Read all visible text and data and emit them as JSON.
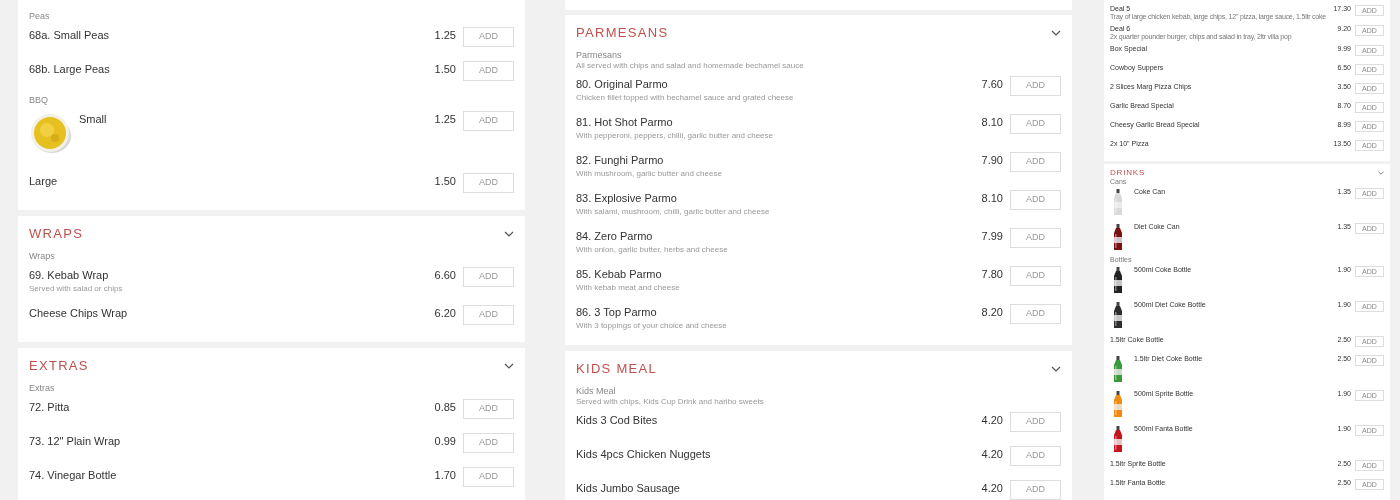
{
  "columns": [
    {
      "kind": "full",
      "cards": [
        {
          "groups": [
            {
              "label": "Peas",
              "items": [
                {
                  "kind": "plain",
                  "name": "68a. Small Peas",
                  "price": "1.25",
                  "button": "ADD"
                },
                {
                  "kind": "plain",
                  "name": "68b. Large Peas",
                  "price": "1.50",
                  "button": "ADD"
                }
              ]
            },
            {
              "label": "BBQ",
              "items": [
                {
                  "kind": "picture",
                  "name": "Small",
                  "price": "1.25",
                  "button": "ADD"
                },
                {
                  "kind": "plain",
                  "name": "Large",
                  "price": "1.50",
                  "button": "ADD"
                }
              ]
            }
          ]
        },
        {
          "title": "WRAPS",
          "expanded": true,
          "groups": [
            {
              "label": "Wraps",
              "items": [
                {
                  "kind": "plain",
                  "name": "69. Kebab Wrap",
                  "description": "Served with salad or chips",
                  "price": "6.60",
                  "button": "ADD"
                },
                {
                  "kind": "plain",
                  "name": "Cheese Chips Wrap",
                  "price": "6.20",
                  "button": "ADD"
                }
              ]
            }
          ]
        },
        {
          "title": "EXTRAS",
          "expanded": true,
          "groups": [
            {
              "label": "Extras",
              "items": [
                {
                  "kind": "plain",
                  "name": "72. Pitta",
                  "price": "0.85",
                  "button": "ADD"
                },
                {
                  "kind": "plain",
                  "name": "73. 12\" Plain Wrap",
                  "price": "0.99",
                  "button": "ADD"
                },
                {
                  "kind": "plain",
                  "name": "74. Vinegar Bottle",
                  "price": "1.70",
                  "button": "ADD"
                }
              ]
            }
          ]
        }
      ]
    },
    {
      "kind": "full",
      "cards": [
        {
          "title": "PARMESANS",
          "expanded": true,
          "groups": [
            {
              "label": "Parmesans",
              "description": "All served with chips and salad and homemade bechamel sauce",
              "items": [
                {
                  "kind": "plain",
                  "name": "80. Original Parmo",
                  "description": "Chicken fillet topped with bechamel sauce and grated cheese",
                  "price": "7.60",
                  "button": "ADD"
                },
                {
                  "kind": "plain",
                  "name": "81. Hot Shot Parmo",
                  "description": "With pepperoni, peppers, chilli, garlic butter and cheese",
                  "price": "8.10",
                  "button": "ADD"
                },
                {
                  "kind": "plain",
                  "name": "82. Funghi Parmo",
                  "description": "With mushroom, garlic butter and cheese",
                  "price": "7.90",
                  "button": "ADD"
                },
                {
                  "kind": "plain",
                  "name": "83. Explosive Parmo",
                  "description": "With salami, mushroom, chilli, garlic butter and cheese",
                  "price": "8.10",
                  "button": "ADD"
                },
                {
                  "kind": "plain",
                  "name": "84. Zero Parmo",
                  "description": "With onion, garlic butter, herbs and cheese",
                  "price": "7.99",
                  "button": "ADD"
                },
                {
                  "kind": "plain",
                  "name": "85. Kebab Parmo",
                  "description": "With kebab meat and cheese",
                  "price": "7.80",
                  "button": "ADD"
                },
                {
                  "kind": "plain",
                  "name": "86. 3 Top Parmo",
                  "description": "With 3 toppings of your choice and cheese",
                  "price": "8.20",
                  "button": "ADD"
                }
              ]
            }
          ]
        },
        {
          "title": "KIDS MEAL",
          "expanded": true,
          "groups": [
            {
              "label": "Kids Meal",
              "description": "Served with chips, Kids Cup Drink and haribo sweets",
              "items": [
                {
                  "kind": "plain",
                  "name": "Kids 3 Cod Bites",
                  "price": "4.20",
                  "button": "ADD"
                },
                {
                  "kind": "plain",
                  "name": "Kids 4pcs Chicken Nuggets",
                  "price": "4.20",
                  "button": "ADD"
                },
                {
                  "kind": "plain",
                  "name": "Kids Jumbo Sausage",
                  "price": "4.20",
                  "button": "ADD"
                }
              ]
            }
          ]
        }
      ]
    },
    {
      "kind": "miniature",
      "cards": [
        {
          "groups": [
            {
              "items": [
                {
                  "kind": "plain",
                  "name": "Deal 5",
                  "description": "Tray of large chicken kebab, large chips, 12\" pizza, large sauce, 1.5ltr coke",
                  "price": "17.30",
                  "button": "ADD"
                },
                {
                  "kind": "plain",
                  "name": "Deal 6",
                  "description": "2x quarter pounder burger, chips and salad in tray, 2ltr villa pop",
                  "price": "9.20",
                  "button": "ADD"
                },
                {
                  "kind": "plain",
                  "name": "Box Special",
                  "price": "9.99",
                  "button": "ADD"
                },
                {
                  "kind": "plain",
                  "name": "Cowboy Suppers",
                  "price": "6.50",
                  "button": "ADD"
                },
                {
                  "kind": "plain",
                  "name": "2 Slices Marg Pizza Chips",
                  "price": "3.50",
                  "button": "ADD"
                },
                {
                  "kind": "plain",
                  "name": "Garlic Bread Special",
                  "price": "8.70",
                  "button": "ADD"
                },
                {
                  "kind": "plain",
                  "name": "Cheesy Garlic Bread Special",
                  "price": "8.99",
                  "button": "ADD"
                },
                {
                  "kind": "plain",
                  "name": "2x 10\" Pizza",
                  "price": "13.50",
                  "button": "ADD"
                }
              ]
            }
          ]
        },
        {
          "title": "DRINKS",
          "expanded": true,
          "groups": [
            {
              "label": "Cans",
              "items": [
                {
                  "kind": "picture",
                  "name": "Coke Can",
                  "price": "1.35",
                  "button": "ADD"
                },
                {
                  "kind": "picture",
                  "name": "Diet Coke Can",
                  "price": "1.35",
                  "button": "ADD"
                }
              ]
            },
            {
              "label": "Bottles",
              "items": [
                {
                  "kind": "picture",
                  "name": "500ml Coke Bottle",
                  "price": "1.90",
                  "button": "ADD"
                },
                {
                  "kind": "picture",
                  "name": "500ml Diet Coke Bottle",
                  "price": "1.90",
                  "button": "ADD"
                },
                {
                  "kind": "plain",
                  "name": "1.5ltr Coke Bottle",
                  "price": "2.50",
                  "button": "ADD"
                },
                {
                  "kind": "picture",
                  "name": "1.5ltr Diet Coke Bottle",
                  "price": "2.50",
                  "button": "ADD"
                },
                {
                  "kind": "picture",
                  "name": "500ml Sprite Bottle",
                  "price": "1.90",
                  "button": "ADD"
                },
                {
                  "kind": "picture",
                  "name": "500ml Fanta Bottle",
                  "price": "1.90",
                  "button": "ADD"
                },
                {
                  "kind": "plain",
                  "name": "1.5ltr Sprite Bottle",
                  "price": "2.50",
                  "button": "ADD"
                },
                {
                  "kind": "plain",
                  "name": "1.5ltr Fanta Bottle",
                  "price": "2.50",
                  "button": "ADD"
                }
              ]
            }
          ]
        }
      ]
    }
  ]
}
